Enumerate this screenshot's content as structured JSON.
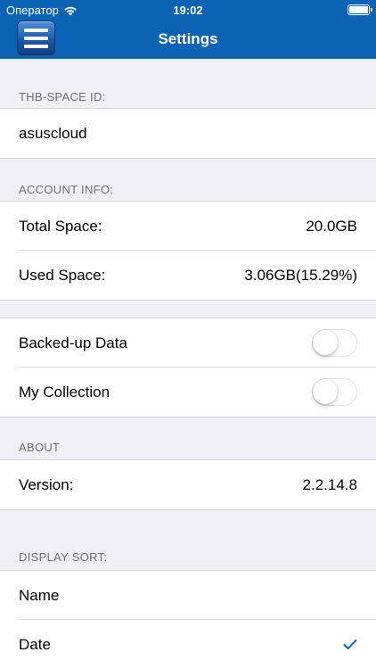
{
  "status": {
    "carrier": "Оператор",
    "time": "19:02"
  },
  "nav": {
    "title": "Settings"
  },
  "sections": {
    "space_id": {
      "header": "THB-SPACE ID:",
      "value": "asuscloud"
    },
    "account": {
      "header": "ACCOUNT INFO:",
      "total_label": "Total Space:",
      "total_value": "20.0GB",
      "used_label": "Used Space:",
      "used_value": "3.06GB(15.29%)"
    },
    "toggles": {
      "backed_up_label": "Backed-up Data",
      "backed_up_on": false,
      "collection_label": "My Collection",
      "collection_on": false
    },
    "about": {
      "header": "ABOUT",
      "version_label": "Version:",
      "version_value": "2.2.14.8"
    },
    "sort": {
      "header": "DISPLAY SORT:",
      "options": [
        "Name",
        "Date"
      ],
      "selected": "Date"
    }
  },
  "colors": {
    "nav_bg": "#0a63b4",
    "accent": "#0a63b4",
    "group_bg": "#efeff4"
  }
}
